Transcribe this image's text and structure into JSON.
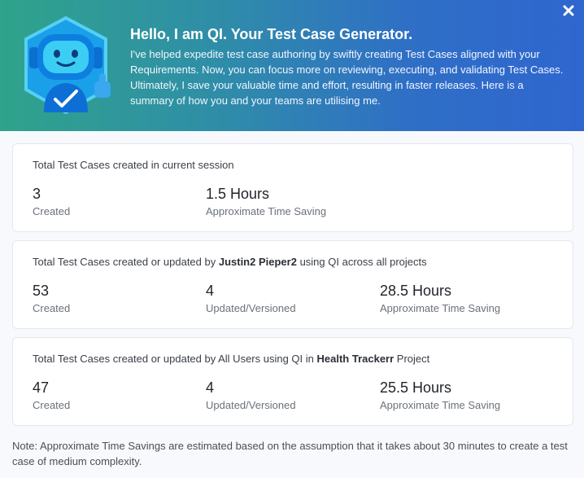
{
  "header": {
    "title": "Hello, I am QI. Your Test Case Generator.",
    "description": "I've helped expedite test case authoring by swiftly creating Test Cases aligned with your Requirements. Now, you can focus more on reviewing, executing, and validating Test Cases. Ultimately, I save your valuable time and effort, resulting in faster releases. Here is a summary of how you and your teams are utilising me.",
    "close_icon": "close-icon",
    "mascot_icon": "robot-thumbs-up-icon"
  },
  "session_card": {
    "title": "Total Test Cases created in current session",
    "created_value": "3",
    "created_label": "Created",
    "time_value": "1.5 Hours",
    "time_label": "Approximate Time Saving"
  },
  "user_card": {
    "title_prefix": "Total Test Cases created or updated by ",
    "user_name": "Justin2 Pieper2",
    "title_suffix": " using QI across all projects",
    "created_value": "53",
    "created_label": "Created",
    "updated_value": "4",
    "updated_label": "Updated/Versioned",
    "time_value": "28.5 Hours",
    "time_label": "Approximate Time Saving"
  },
  "project_card": {
    "title_prefix": "Total Test Cases created or updated by All Users using QI in ",
    "project_name": "Health Trackerr",
    "title_suffix": " Project",
    "created_value": "47",
    "created_label": "Created",
    "updated_value": "4",
    "updated_label": "Updated/Versioned",
    "time_value": "25.5 Hours",
    "time_label": "Approximate Time Saving"
  },
  "note": "Note: Approximate Time Savings are estimated based on the assumption that it takes about 30 minutes to create a test case of medium complexity.",
  "colors": {
    "banner_start": "#2fa38b",
    "banner_end": "#2f66cf",
    "mascot_body": "#1e90ff",
    "mascot_face": "#36c3f0"
  }
}
